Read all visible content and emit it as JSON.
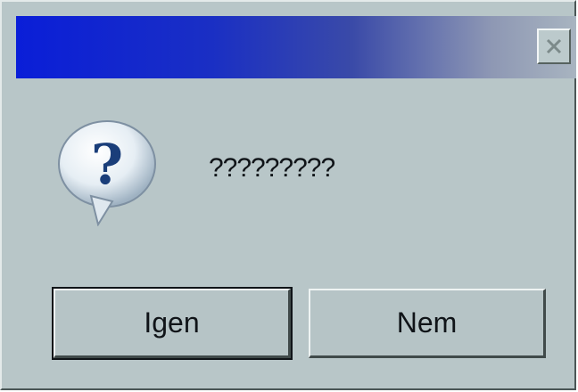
{
  "dialog": {
    "close_symbol": "X",
    "message": "?????????",
    "icon": "question-icon",
    "icon_glyph": "?",
    "buttons": {
      "yes_label": "Igen",
      "no_label": "Nem"
    }
  },
  "colors": {
    "title_gradient_start": "#0a1ed8",
    "title_gradient_end": "#a8b4c0",
    "dialog_background": "#b8c6c8",
    "text": "#101418"
  }
}
